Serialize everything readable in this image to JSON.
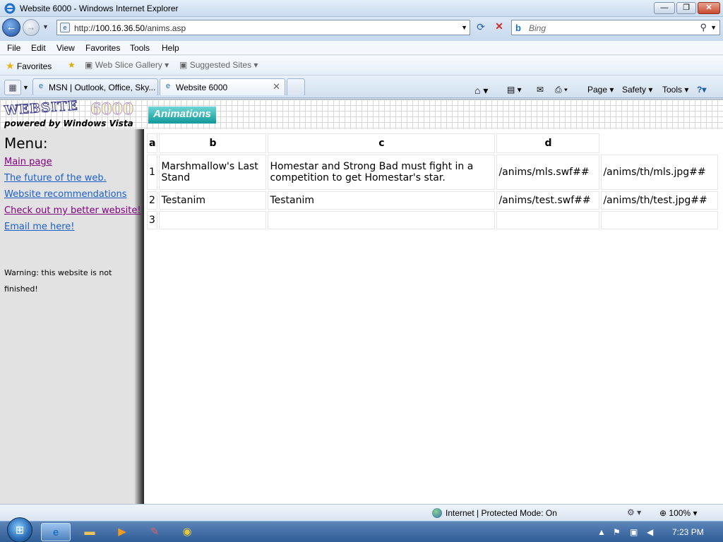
{
  "window": {
    "title": "Website 6000 - Windows Internet Explorer"
  },
  "address": {
    "url_prefix": "http://",
    "url_host": "100.16.36.50",
    "url_path": "/anims.asp"
  },
  "search": {
    "placeholder": "Bing"
  },
  "menubar": [
    "File",
    "Edit",
    "View",
    "Favorites",
    "Tools",
    "Help"
  ],
  "favorites": {
    "label": "Favorites",
    "web_slice": "Web Slice Gallery",
    "suggested": "Suggested Sites"
  },
  "tabs": [
    {
      "title": "MSN | Outlook, Office, Sky..."
    },
    {
      "title": "Website 6000"
    }
  ],
  "commandbar": {
    "page": "Page",
    "safety": "Safety",
    "tools": "Tools"
  },
  "site": {
    "logo_word": "WEBSITE",
    "logo_num": "6000",
    "powered": "powered by Windows Vista",
    "section_title": "Animations"
  },
  "sidebar": {
    "heading": "Menu:",
    "links": [
      {
        "label": "Main page"
      },
      {
        "label": "The future of the web."
      },
      {
        "label": "Website recommendations"
      },
      {
        "label": "Check out my better website!"
      },
      {
        "label": "Email me here!"
      }
    ],
    "warning": "Warning: this website is not finished!"
  },
  "table": {
    "headers": [
      "a",
      "b",
      "c",
      "d",
      ""
    ],
    "rows": [
      [
        "1",
        "Marshmallow's Last Stand",
        "Homestar and Strong Bad must fight in a competition to get Homestar's star.",
        "/anims/mls.swf##",
        "/anims/th/mls.jpg##"
      ],
      [
        "2",
        "Testanim",
        "Testanim",
        "/anims/test.swf##",
        "/anims/th/test.jpg##"
      ],
      [
        "3",
        "",
        "",
        "",
        ""
      ]
    ]
  },
  "status": {
    "zone": "Internet | Protected Mode: On",
    "zoom": "100%"
  },
  "taskbar": {
    "clock": "7:23 PM"
  }
}
